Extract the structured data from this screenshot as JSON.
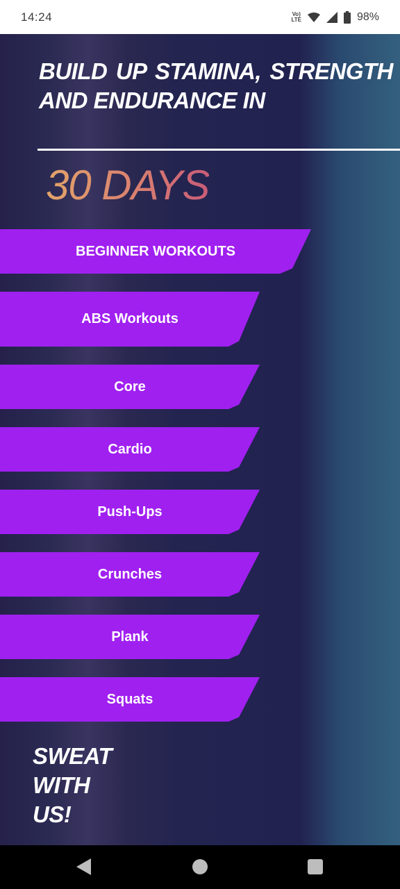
{
  "status_bar": {
    "time": "14:24",
    "volte_top": "Vo)",
    "volte_bottom": "LTE",
    "battery": "98%",
    "icons": [
      "volte-icon",
      "wifi-icon",
      "cellular-signal-icon",
      "battery-icon"
    ]
  },
  "main": {
    "headline": "BUILD UP STAMINA, STRENGTH AND ENDURANCE IN",
    "days": "30 DAYS",
    "slogan": "SWEAT WITH US!"
  },
  "workouts": [
    {
      "label": "BEGINNER WORKOUTS"
    },
    {
      "label": "ABS Workouts"
    },
    {
      "label": "Core"
    },
    {
      "label": "Cardio"
    },
    {
      "label": "Push-Ups"
    },
    {
      "label": "Crunches"
    },
    {
      "label": "Plank"
    },
    {
      "label": "Squats"
    }
  ],
  "colors": {
    "button": "#a020f0",
    "days_gradient_start": "#e3a46a",
    "days_gradient_end": "#c85c78",
    "background_dark": "#232450",
    "background_right": "#34607e"
  },
  "nav_bar": {
    "icons": [
      "back-icon",
      "home-icon",
      "recent-apps-icon"
    ]
  }
}
